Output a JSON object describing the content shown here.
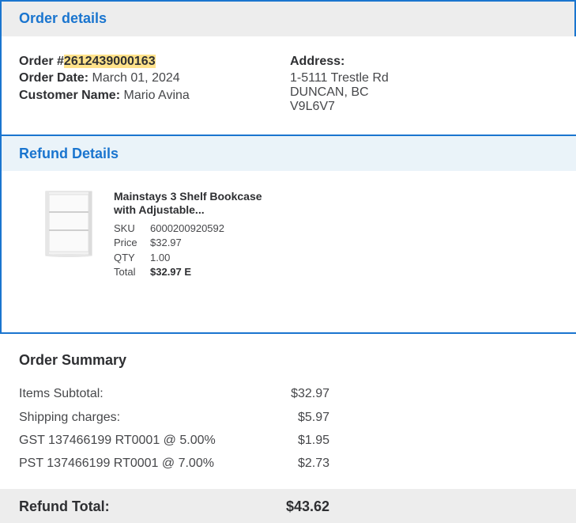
{
  "order_details": {
    "title": "Order details",
    "order_label": "Order #",
    "order_number": "2612439000163",
    "order_date_label": "Order Date:",
    "order_date": "March 01, 2024",
    "customer_label": "Customer Name:",
    "customer_name": "Mario Avina",
    "address_label": "Address:",
    "address_line1": "1-5111 Trestle Rd",
    "address_line2": "DUNCAN, BC",
    "address_line3": "V9L6V7"
  },
  "refund_details": {
    "title": "Refund Details",
    "item": {
      "name_line1": "Mainstays 3 Shelf Bookcase",
      "name_line2": "with Adjustable...",
      "sku_label": "SKU",
      "sku": "6000200920592",
      "price_label": "Price",
      "price": "$32.97",
      "qty_label": "QTY",
      "qty": "1.00",
      "total_label": "Total",
      "total": "$32.97 E"
    }
  },
  "order_summary": {
    "title": "Order Summary",
    "rows": [
      {
        "label": "Items Subtotal:",
        "value": "$32.97"
      },
      {
        "label": "Shipping charges:",
        "value": "$5.97"
      },
      {
        "label": "GST 137466199 RT0001 @ 5.00%",
        "value": "$1.95"
      },
      {
        "label": "PST 137466199 RT0001 @ 7.00%",
        "value": "$2.73"
      }
    ],
    "refund_total_label": "Refund Total:",
    "refund_total": "$43.62"
  },
  "colors": {
    "accent": "#1a75cf",
    "highlight": "#ffe28a",
    "header_gray": "#ededed",
    "header_blue": "#eaf3f9"
  }
}
